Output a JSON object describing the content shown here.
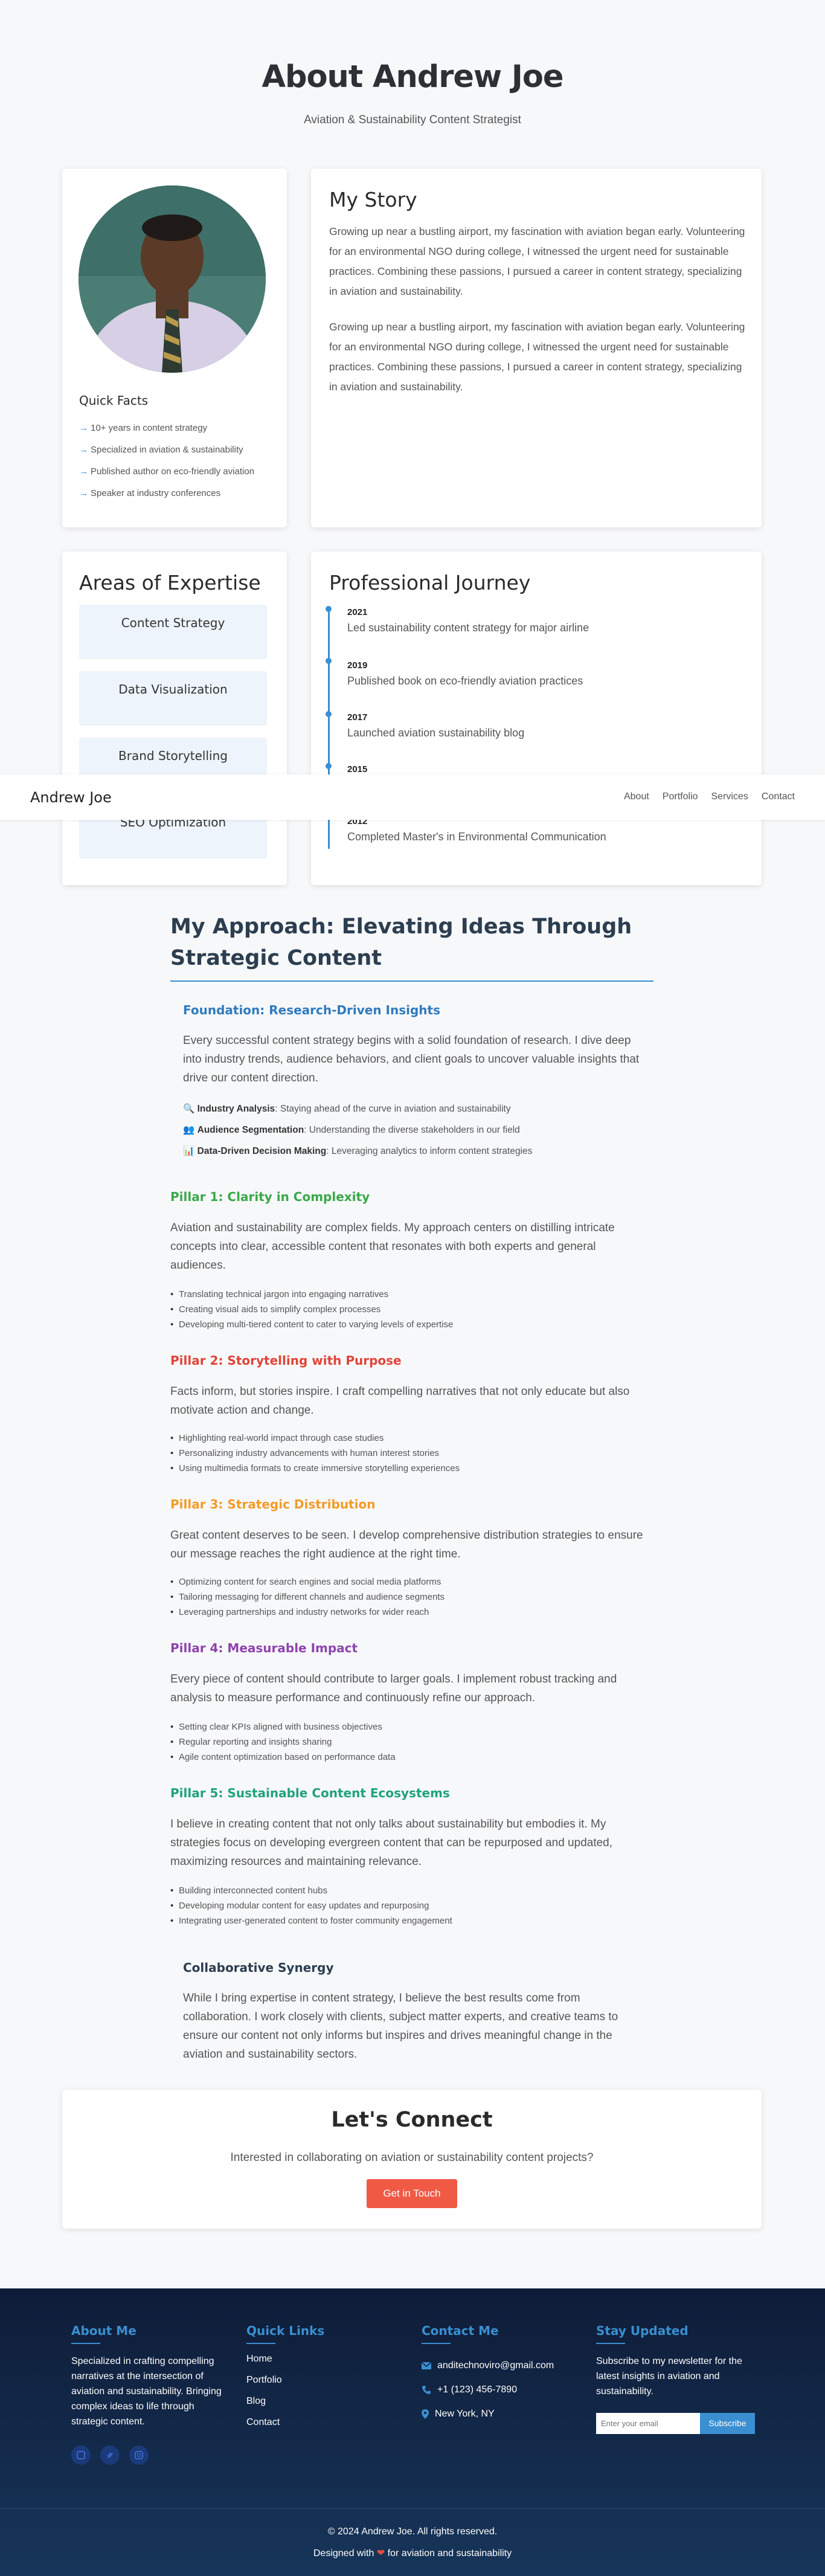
{
  "hero": {
    "title": "About Andrew Joe",
    "subtitle": "Aviation & Sustainability Content Strategist"
  },
  "profile": {
    "quick_facts_title": "Quick Facts",
    "facts": [
      "10+ years in content strategy",
      "Specialized in aviation & sustainability",
      "Published author on eco-friendly aviation",
      "Speaker at industry conferences"
    ]
  },
  "story": {
    "title": "My Story",
    "paragraphs": [
      "Growing up near a bustling airport, my fascination with aviation began early. Volunteering for an environmental NGO during college, I witnessed the urgent need for sustainable practices. Combining these passions, I pursued a career in content strategy, specializing in aviation and sustainability.",
      "Growing up near a bustling airport, my fascination with aviation began early. Volunteering for an environmental NGO during college, I witnessed the urgent need for sustainable practices. Combining these passions, I pursued a career in content strategy, specializing in aviation and sustainability."
    ]
  },
  "expertise": {
    "title": "Areas of Expertise",
    "items": [
      "Content Strategy",
      "Data Visualization",
      "Brand Storytelling",
      "SEO Optimization"
    ]
  },
  "journey": {
    "title": "Professional Journey",
    "items": [
      {
        "year": "2021",
        "text": "Led sustainability content strategy for major airline"
      },
      {
        "year": "2019",
        "text": "Published book on eco-friendly aviation practices"
      },
      {
        "year": "2017",
        "text": "Launched aviation sustainability blog"
      },
      {
        "year": "2015",
        "text": ""
      },
      {
        "year": "2012",
        "text": "Completed Master's in Environmental Communication"
      }
    ]
  },
  "nav": {
    "brand": "Andrew Joe",
    "links": [
      "About",
      "Portfolio",
      "Services",
      "Contact"
    ]
  },
  "approach": {
    "title": "My Approach: Elevating Ideas Through Strategic Content",
    "foundation": {
      "heading": "Foundation: Research-Driven Insights",
      "text": "Every successful content strategy begins with a solid foundation of research. I dive deep into industry trends, audience behaviors, and client goals to uncover valuable insights that drive our content direction.",
      "features": [
        {
          "icon": "🔍",
          "label": "Industry Analysis",
          "desc": ": Staying ahead of the curve in aviation and sustainability"
        },
        {
          "icon": "👥",
          "label": "Audience Segmentation",
          "desc": ": Understanding the diverse stakeholders in our field"
        },
        {
          "icon": "📊",
          "label": "Data-Driven Decision Making",
          "desc": ": Leveraging analytics to inform content strategies"
        }
      ]
    },
    "pillars": [
      {
        "heading": "Pillar 1: Clarity in Complexity",
        "color": "#3aa84a",
        "text": "Aviation and sustainability are complex fields. My approach centers on distilling intricate concepts into clear, accessible content that resonates with both experts and general audiences.",
        "items": [
          "Translating technical jargon into engaging narratives",
          "Creating visual aids to simplify complex processes",
          "Developing multi-tiered content to cater to varying levels of expertise"
        ]
      },
      {
        "heading": "Pillar 2: Storytelling with Purpose",
        "color": "#e0453a",
        "text": "Facts inform, but stories inspire. I craft compelling narratives that not only educate but also motivate action and change.",
        "items": [
          "Highlighting real-world impact through case studies",
          "Personalizing industry advancements with human interest stories",
          "Using multimedia formats to create immersive storytelling experiences"
        ]
      },
      {
        "heading": "Pillar 3: Strategic Distribution",
        "color": "#f39c28",
        "text": "Great content deserves to be seen. I develop comprehensive distribution strategies to ensure our message reaches the right audience at the right time.",
        "items": [
          "Optimizing content for search engines and social media platforms",
          "Tailoring messaging for different channels and audience segments",
          "Leveraging partnerships and industry networks for wider reach"
        ]
      },
      {
        "heading": "Pillar 4: Measurable Impact",
        "color": "#8e44ad",
        "text": "Every piece of content should contribute to larger goals. I implement robust tracking and analysis to measure performance and continuously refine our approach.",
        "items": [
          "Setting clear KPIs aligned with business objectives",
          "Regular reporting and insights sharing",
          "Agile content optimization based on performance data"
        ]
      },
      {
        "heading": "Pillar 5: Sustainable Content Ecosystems",
        "color": "#1fa37a",
        "text": "I believe in creating content that not only talks about sustainability but embodies it. My strategies focus on developing evergreen content that can be repurposed and updated, maximizing resources and maintaining relevance.",
        "items": [
          "Building interconnected content hubs",
          "Developing modular content for easy updates and repurposing",
          "Integrating user-generated content to foster community engagement"
        ]
      }
    ],
    "synergy": {
      "heading": "Collaborative Synergy",
      "text": "While I bring expertise in content strategy, I believe the best results come from collaboration. I work closely with clients, subject matter experts, and creative teams to ensure our content not only informs but inspires and drives meaningful change in the aviation and sustainability sectors."
    }
  },
  "connect": {
    "title": "Let's Connect",
    "text": "Interested in collaborating on aviation or sustainability content projects?",
    "button": "Get in Touch"
  },
  "footer": {
    "about_title": "About Me",
    "about_text": "Specialized in crafting compelling narratives at the intersection of aviation and sustainability. Bringing complex ideas to life through strategic content.",
    "links_title": "Quick Links",
    "links": [
      "Home",
      "Portfolio",
      "Blog",
      "Contact"
    ],
    "contact_title": "Contact Me",
    "email": "anditechnoviro@gmail.com",
    "phone": "+1 (123) 456-7890",
    "location": "New York, NY",
    "news_title": "Stay Updated",
    "news_text": "Subscribe to my newsletter for the latest insights in aviation and sustainability.",
    "email_placeholder": "Enter your email",
    "subscribe": "Subscribe",
    "copyright": "© 2024 Andrew Joe. All rights reserved.",
    "designed_prefix": "Designed with",
    "designed_suffix": "for aviation and sustainability"
  },
  "colors": {
    "accent": "#3a8fd1",
    "cta": "#f05a45",
    "footer_bg": "#0e1c38"
  }
}
